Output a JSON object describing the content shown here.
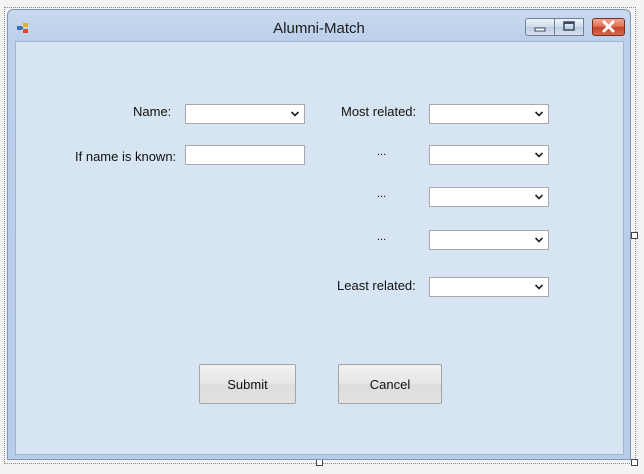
{
  "window": {
    "title": "Alumni-Match",
    "icon": "app-form-icon"
  },
  "titlebar_controls": {
    "minimize_icon": "minimize-icon",
    "maximize_icon": "maximize-icon",
    "close_icon": "close-icon"
  },
  "form": {
    "name_label": "Name:",
    "name_value": "",
    "if_known_label": "If name is known:",
    "if_known_value": "",
    "rank_labels": [
      "Most related:",
      "...",
      "...",
      "...",
      "Least related:"
    ],
    "rank_values": [
      "",
      "",
      "",
      "",
      ""
    ]
  },
  "buttons": {
    "submit": "Submit",
    "cancel": "Cancel"
  },
  "colors": {
    "client_bg": "#d7e4f2",
    "close_red": "#c5432a"
  }
}
